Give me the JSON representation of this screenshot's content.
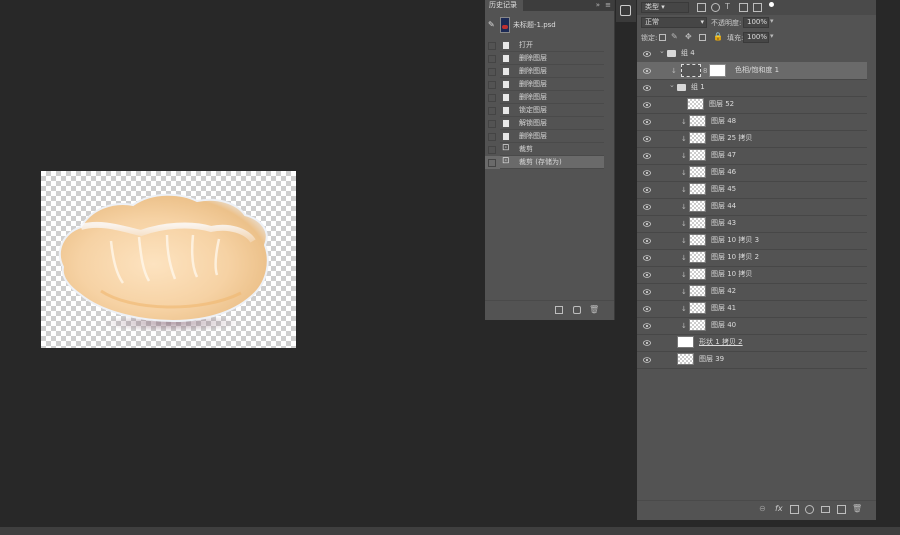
{
  "history_panel": {
    "tab_label": "历史记录",
    "snapshot_label": "未标题-1.psd",
    "steps": [
      "打开",
      "删除图层",
      "删除图层",
      "删除图层",
      "删除图层",
      "锁定图层",
      "解锁图层",
      "删除图层",
      "裁剪",
      "裁剪 (存储为)"
    ]
  },
  "layers_panel": {
    "filter_label": "类型",
    "blend_mode": "正常",
    "opacity_label": "不透明度:",
    "opacity_value": "100%",
    "lock_label": "锁定:",
    "fill_label": "填充:",
    "fill_value": "100%",
    "layers": [
      {
        "name": "组 4",
        "kind": "group",
        "indent": 0
      },
      {
        "name": "色相/饱和度 1",
        "kind": "adjust",
        "indent": 1,
        "selected": true
      },
      {
        "name": "组 1",
        "kind": "group",
        "indent": 1
      },
      {
        "name": "图层 52",
        "kind": "layer",
        "indent": 2
      },
      {
        "name": "图层 48",
        "kind": "clip",
        "indent": 2
      },
      {
        "name": "图层 25 拷贝",
        "kind": "clip",
        "indent": 2
      },
      {
        "name": "图层 47",
        "kind": "clip",
        "indent": 2
      },
      {
        "name": "图层 46",
        "kind": "clip",
        "indent": 2
      },
      {
        "name": "图层 45",
        "kind": "clip",
        "indent": 2
      },
      {
        "name": "图层 44",
        "kind": "clip",
        "indent": 2
      },
      {
        "name": "图层 43",
        "kind": "clip",
        "indent": 2
      },
      {
        "name": "图层 10 拷贝 3",
        "kind": "clip",
        "indent": 2
      },
      {
        "name": "图层 10 拷贝 2",
        "kind": "clip",
        "indent": 2
      },
      {
        "name": "图层 10 拷贝",
        "kind": "clip",
        "indent": 2
      },
      {
        "name": "图层 42",
        "kind": "clip",
        "indent": 2
      },
      {
        "name": "图层 41",
        "kind": "clip",
        "indent": 2
      },
      {
        "name": "图层 40",
        "kind": "clip",
        "indent": 2
      },
      {
        "name": "形状 1 拷贝 2",
        "kind": "shape",
        "indent": 1
      },
      {
        "name": "图层 39",
        "kind": "layer",
        "indent": 1
      }
    ]
  },
  "colors": {
    "bg": "#282828",
    "panel": "#535353",
    "selected": "#6a6a6a"
  }
}
